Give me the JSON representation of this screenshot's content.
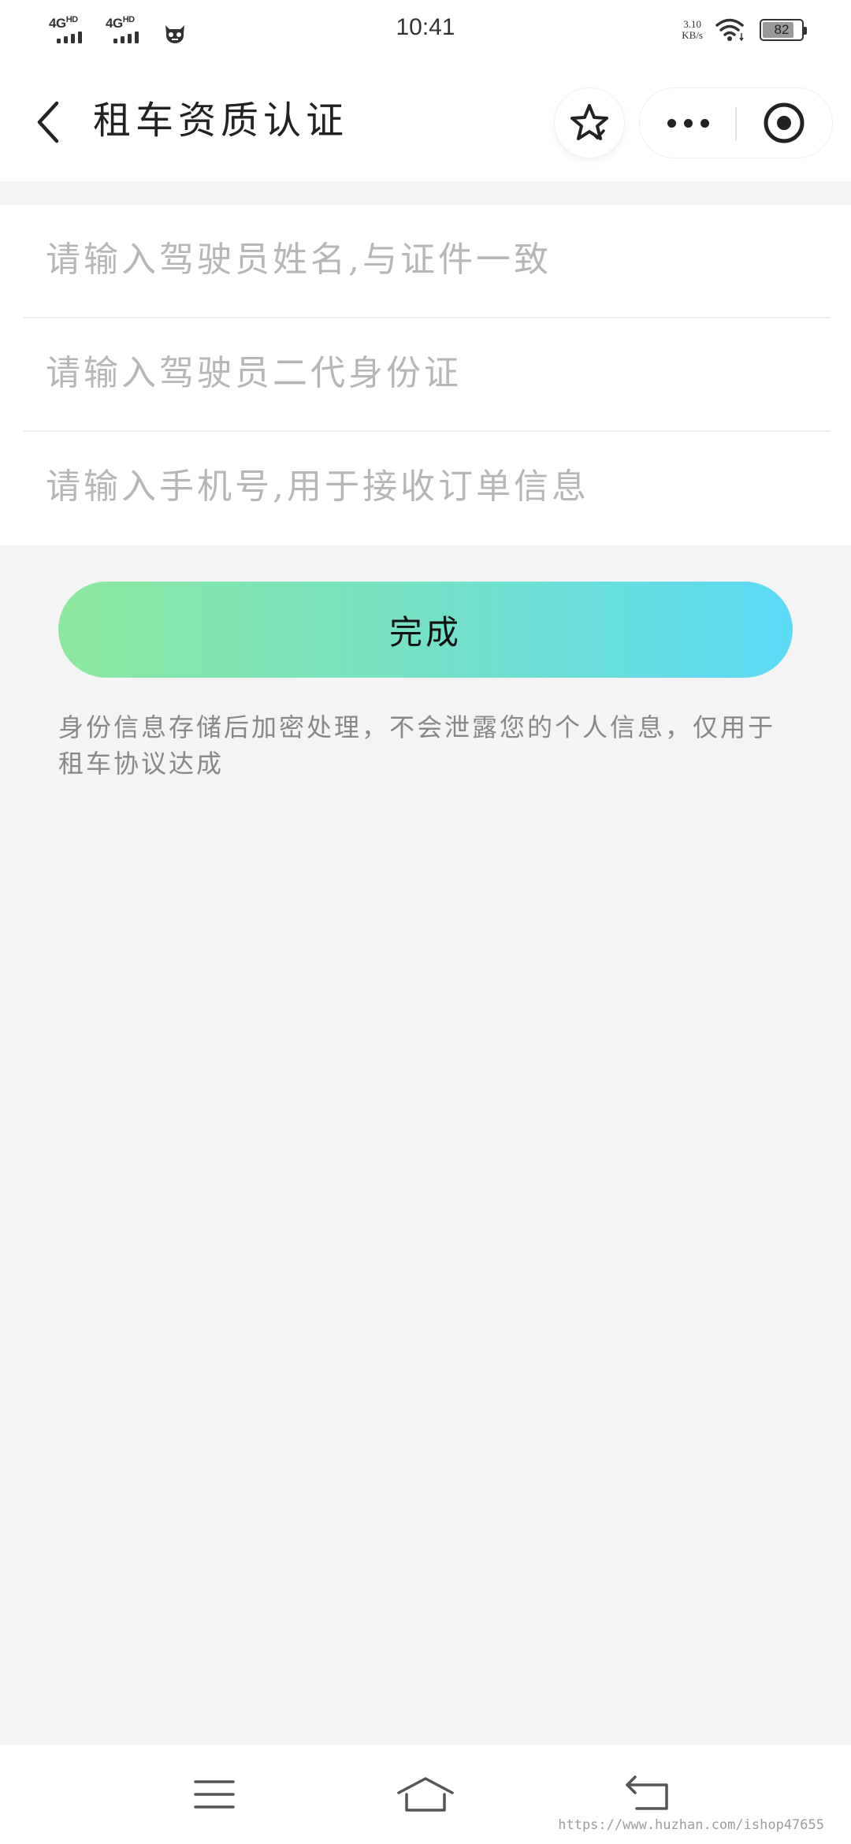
{
  "status_bar": {
    "network_1": "4G",
    "network_1_sup": "HD",
    "network_2": "4G",
    "network_2_sup": "HD",
    "time": "10:41",
    "speed_value": "3.10",
    "speed_unit": "KB/s",
    "battery": "82",
    "battery_level": 0.82
  },
  "navbar": {
    "title": "租车资质认证"
  },
  "form": {
    "fields": [
      {
        "placeholder": "请输入驾驶员姓名,与证件一致",
        "value": ""
      },
      {
        "placeholder": "请输入驾驶员二代身份证",
        "value": ""
      },
      {
        "placeholder": "请输入手机号,用于接收订单信息",
        "value": ""
      }
    ]
  },
  "submit": {
    "label": "完成",
    "gradient_start": "#8ce89e",
    "gradient_end": "#5cdaf6"
  },
  "notice": "身份信息存储后加密处理，不会泄露您的个人信息，仅用于租车协议达成",
  "watermark": "https://www.huzhan.com/ishop47655",
  "icons": {
    "back": "chevron-left-icon",
    "favorite": "star-icon",
    "more": "more-dots-icon",
    "close": "target-close-icon",
    "menu": "menu-icon",
    "home": "home-icon",
    "return": "return-icon"
  }
}
